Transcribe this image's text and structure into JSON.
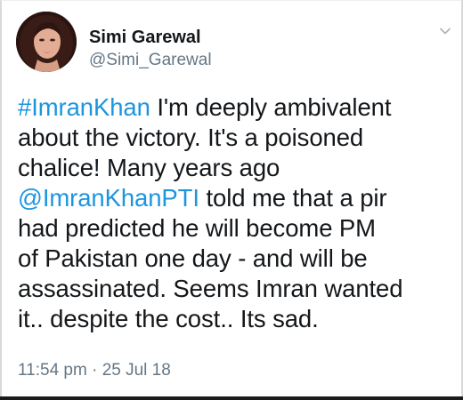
{
  "author": {
    "name": "Simi Garewal",
    "handle": "@Simi_Garewal"
  },
  "tweet": {
    "lines": [
      {
        "link": "#ImranKhan",
        "text": " I'm deeply ambivalent"
      },
      {
        "text": "about the victory.  It's a poisoned"
      },
      {
        "text": "chalice! Many years ago"
      },
      {
        "link": "@ImranKhanPTI",
        "text": " told me that a pir"
      },
      {
        "text": "had predicted he will become PM"
      },
      {
        "text": "of Pakistan one day - and will be"
      },
      {
        "text": "assassinated. Seems Imran wanted"
      },
      {
        "text": "it.. despite the cost.. Its sad."
      }
    ],
    "timestamp": "11:54 pm · 25 Jul 18"
  },
  "icons": {
    "avatar": "profile-photo",
    "menu": "chevron-down-icon"
  },
  "colors": {
    "link": "#1b95e0",
    "text": "#14171a",
    "secondary": "#657786"
  }
}
